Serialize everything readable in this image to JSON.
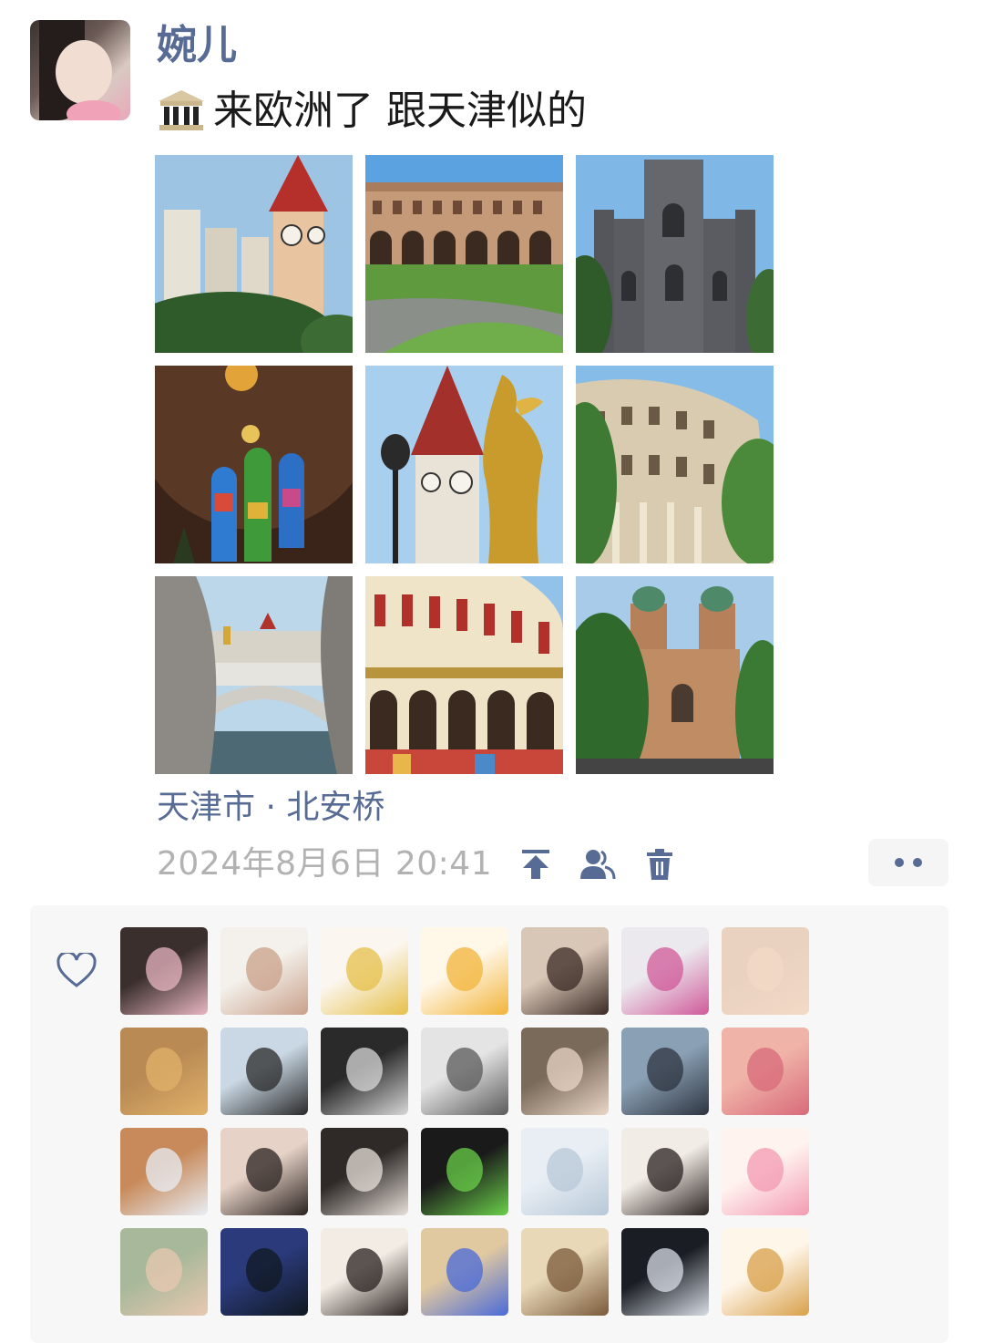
{
  "post": {
    "author": "婉儿",
    "icon": "classical-building-emoji",
    "text": "来欧洲了 跟天津似的",
    "location": "天津市 · 北安桥",
    "time": "2024年8月6日 20:41"
  },
  "photos": [
    {
      "name": "clock-tower-photo",
      "subject": "clock tower with high-rise"
    },
    {
      "name": "colonnade-plaza-photo",
      "subject": "arched colonnade and plaza"
    },
    {
      "name": "gothic-church-photo",
      "subject": "grey gothic church"
    },
    {
      "name": "stained-glass-photo",
      "subject": "stained glass windows"
    },
    {
      "name": "golden-statue-photo",
      "subject": "golden statue and clock tower"
    },
    {
      "name": "curved-building-photo",
      "subject": "curved European building"
    },
    {
      "name": "bridge-photo",
      "subject": "ornate bridge over river"
    },
    {
      "name": "arcade-building-photo",
      "subject": "red and cream arcade building"
    },
    {
      "name": "cathedral-photo",
      "subject": "domed cathedral with trees"
    }
  ],
  "toolbar": {
    "icons": [
      "pin-to-top-icon",
      "visibility-friends-icon",
      "delete-icon"
    ],
    "more_icon": "more-dots-icon"
  },
  "likes": {
    "icon": "heart-outline-icon",
    "avatar_count": 28
  },
  "colors": {
    "link": "#576b95",
    "timestamp": "#b2b2b2",
    "panel": "#f7f7f7"
  }
}
